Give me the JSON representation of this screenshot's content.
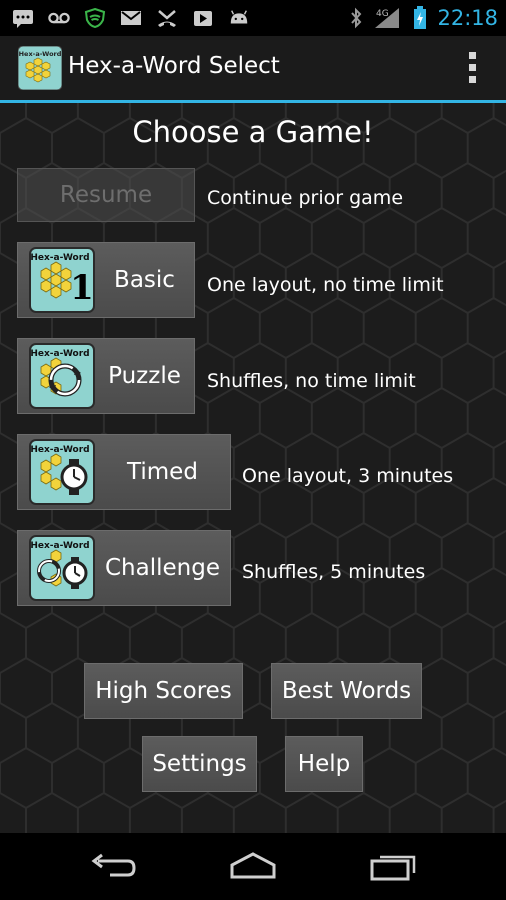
{
  "status_bar": {
    "time": "22:18",
    "network": "4G",
    "icons": [
      "message-icon",
      "voicemail-icon",
      "shield-icon",
      "gmail-icon",
      "missed-call-icon",
      "play-store-icon",
      "android-icon",
      "bluetooth-icon",
      "signal-icon",
      "battery-charging-icon"
    ]
  },
  "action_bar": {
    "title": "Hex-a-Word Select",
    "icon_name": "hex-a-word-app-icon",
    "overflow_icon": "overflow-menu-icon"
  },
  "main": {
    "heading": "Choose a Game!",
    "resume": {
      "label": "Resume",
      "description": "Continue prior game",
      "enabled": false
    },
    "modes": [
      {
        "label": "Basic",
        "description": "One layout, no time limit",
        "icon": "basic-mode-icon"
      },
      {
        "label": "Puzzle",
        "description": "Shuffles, no time limit",
        "icon": "puzzle-mode-icon"
      },
      {
        "label": "Timed",
        "description": "One layout, 3 minutes",
        "icon": "timed-mode-icon"
      },
      {
        "label": "Challenge",
        "description": "Shuffles, 5 minutes",
        "icon": "challenge-mode-icon"
      }
    ],
    "icon_text": "Hex-a-Word",
    "buttons": {
      "high_scores": "High Scores",
      "best_words": "Best Words",
      "settings": "Settings",
      "help": "Help"
    }
  },
  "nav_bar": {
    "icons": [
      "back-icon",
      "home-icon",
      "recent-apps-icon"
    ]
  },
  "colors": {
    "accent": "#33b5e5",
    "button": "#545454",
    "background": "#1c1c1c",
    "icon_teal": "#8fd3cf",
    "icon_hex_yellow": "#f2d33b"
  }
}
